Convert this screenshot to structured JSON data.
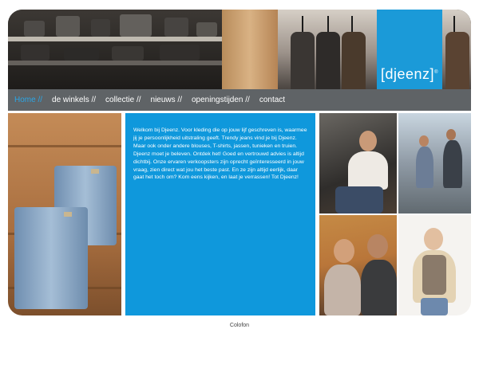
{
  "brand": {
    "logo_text": "[djeenz]",
    "logo_mark": "®",
    "accent_color": "#1b9ad8",
    "nav_bg_color": "#5f6366"
  },
  "nav": {
    "items": [
      {
        "label": "Home //",
        "active": true
      },
      {
        "label": "de winkels //",
        "active": false
      },
      {
        "label": "collectie //",
        "active": false
      },
      {
        "label": "nieuws //",
        "active": false
      },
      {
        "label": "openingstijden //",
        "active": false
      },
      {
        "label": "contact",
        "active": false
      }
    ]
  },
  "main": {
    "paragraph_1": "Welkom bij Djeenz. Voor kleding die op jouw lijf geschreven is, waarmee jij je persoonlijkheid uitstraling geeft. Trendy jeans vind je bij Djeenz. Maar ook onder andere blouses, T-shirts, jassen, tunieken en truien.",
    "paragraph_2": "Djeenz moet je beleven. Ontdek het! Goed en vertrouwd advies is altijd dichtbij. Onze ervaren verkoopsters zijn oprecht geïnteresseerd in jouw vraag, zien direct wat jou het beste past. En ze zijn altijd eerlijk, daar gaat het toch om? Kom eens kijken, en laat je verrassen! Tot Djeenz!"
  },
  "footer": {
    "colofon_label": "Colofon"
  }
}
